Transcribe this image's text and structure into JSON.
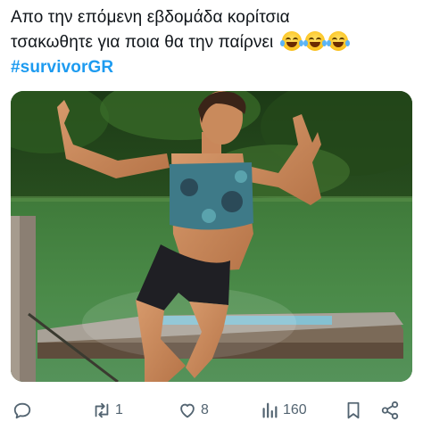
{
  "tweet": {
    "line1": "Απο την επόμενη εβδομάδα κορίτσια",
    "line2": "τσακωθητε για ποια θα την παίρνει",
    "hashtag": "#survivorGR",
    "emoji_name": "face-with-tears-of-joy-icon",
    "emoji_count": 3
  },
  "media": {
    "image_icon": "photo-woman-jumping-off-raft"
  },
  "actions": {
    "reply": {
      "icon": "reply-icon",
      "count": ""
    },
    "retweet": {
      "icon": "retweet-icon",
      "count": "1"
    },
    "like": {
      "icon": "heart-icon",
      "count": "8"
    },
    "views": {
      "icon": "views-icon",
      "count": "160"
    },
    "bookmark": {
      "icon": "bookmark-icon"
    },
    "share": {
      "icon": "share-icon"
    }
  },
  "colors": {
    "text": "#0f1419",
    "hashtag": "#1d9bf0",
    "icon": "#536471"
  }
}
